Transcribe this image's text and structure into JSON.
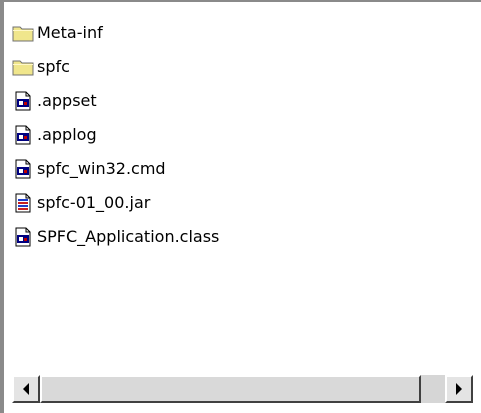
{
  "files": [
    {
      "name": "Meta-inf",
      "icon": "folder-icon",
      "type": "folder"
    },
    {
      "name": "spfc",
      "icon": "folder-icon",
      "type": "folder"
    },
    {
      "name": ".appset",
      "icon": "file-icon",
      "type": "file"
    },
    {
      "name": ".applog",
      "icon": "file-icon",
      "type": "file"
    },
    {
      "name": "spfc_win32.cmd",
      "icon": "file-icon",
      "type": "file"
    },
    {
      "name": "spfc-01_00.jar",
      "icon": "jar-icon",
      "type": "file"
    },
    {
      "name": "SPFC_Application.class",
      "icon": "file-icon",
      "type": "file"
    }
  ],
  "scrollbar": {
    "position": 0,
    "thumb_fraction": 0.94
  },
  "colors": {
    "folder": "#f0e68c",
    "folder_border": "#707070",
    "frame": "#8a8a8a"
  }
}
